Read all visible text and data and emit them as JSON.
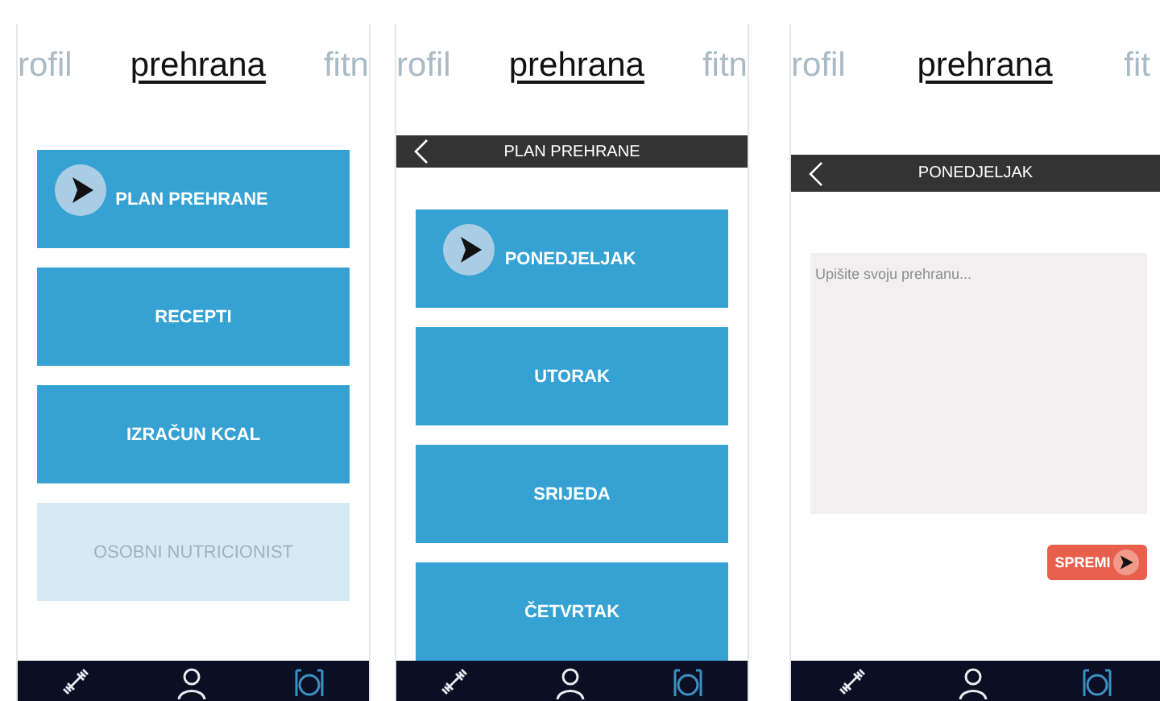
{
  "screens": [
    {
      "kind": "menu",
      "tabs": [
        {
          "label": "rofil",
          "selected": false
        },
        {
          "label": "prehrana",
          "selected": true
        },
        {
          "label": "fitn",
          "selected": false
        }
      ],
      "buttons": [
        {
          "label": "PLAN PREHRANE",
          "disabled": false,
          "touched": true
        },
        {
          "label": "RECEPTI",
          "disabled": false,
          "touched": false
        },
        {
          "label": "IZRAČUN KCAL",
          "disabled": false,
          "touched": false
        },
        {
          "label": "OSOBNI NUTRICIONIST",
          "disabled": true,
          "touched": false
        }
      ],
      "nav": [
        {
          "kind": "dumbbell",
          "selected": false
        },
        {
          "kind": "person",
          "selected": false
        },
        {
          "kind": "plate",
          "selected": true
        }
      ]
    },
    {
      "kind": "list",
      "tabs": [
        {
          "label": "rofil",
          "selected": false
        },
        {
          "label": "prehrana",
          "selected": true
        },
        {
          "label": "fitn",
          "selected": false
        }
      ],
      "header": {
        "title": "PLAN PREHRANE"
      },
      "buttons": [
        {
          "label": "PONEDJELJAK",
          "disabled": false,
          "touched": true
        },
        {
          "label": "UTORAK",
          "disabled": false,
          "touched": false
        },
        {
          "label": "SRIJEDA",
          "disabled": false,
          "touched": false
        },
        {
          "label": "ČETVRTAK",
          "disabled": false,
          "touched": false
        }
      ],
      "nav": [
        {
          "kind": "dumbbell",
          "selected": false
        },
        {
          "kind": "person",
          "selected": false
        },
        {
          "kind": "plate",
          "selected": true
        }
      ]
    },
    {
      "kind": "editor",
      "tabs": [
        {
          "label": "rofil",
          "selected": false
        },
        {
          "label": "prehrana",
          "selected": true
        },
        {
          "label": "fit",
          "selected": false
        }
      ],
      "header": {
        "title": "PONEDJELJAK"
      },
      "editor": {
        "placeholder": "Upišite svoju prehranu..."
      },
      "save_button": {
        "label": "SPREMI",
        "touched": true
      },
      "nav": [
        {
          "kind": "dumbbell",
          "selected": false
        },
        {
          "kind": "person",
          "selected": false
        },
        {
          "kind": "plate",
          "selected": true
        }
      ]
    }
  ]
}
